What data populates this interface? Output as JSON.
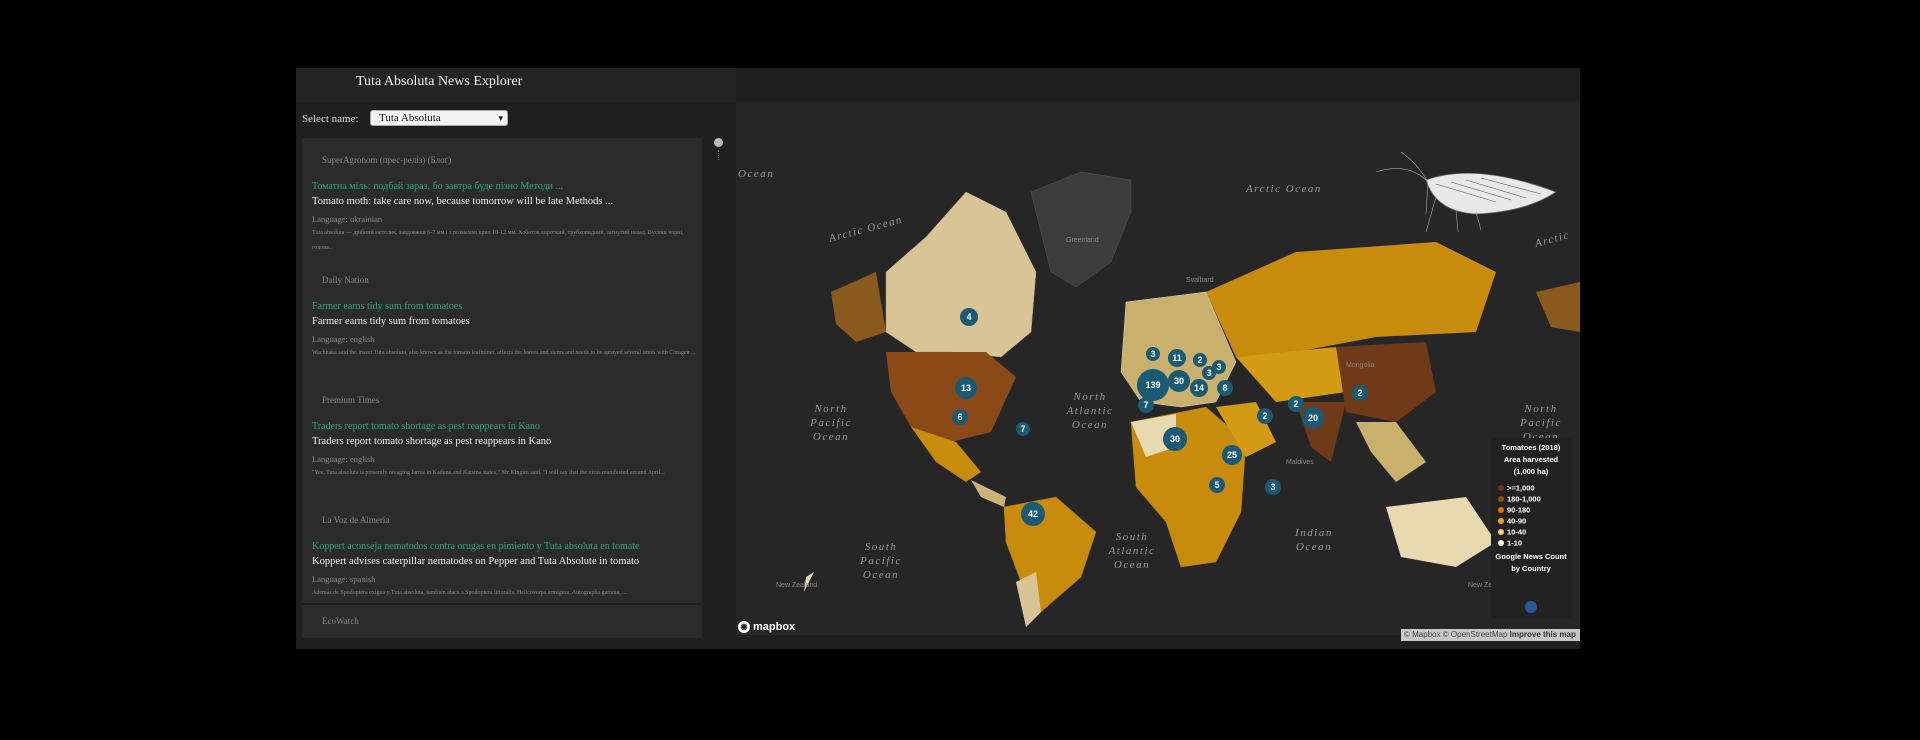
{
  "app": {
    "title": "Tuta Absoluta News Explorer"
  },
  "selector": {
    "label": "Select name:",
    "selected": "Tuta Absoluta"
  },
  "news": [
    {
      "source": "SuperAgronom (прес-реліз) (Блог)",
      "original_title": "Томатна міль: подбай зараз, бо завтра буде пізно Методи ...",
      "translated_title": "Tomato moth: take care now, because tomorrow will be late Methods ...",
      "language": "Language: ukrainian",
      "snippet": "Tuta absoluta — дрібний метелик, завдовжки 6-7 мм і з розмахом крил 10-12 мм. Хоботок короткий, трубковидний, загнутий назад. Вусики чорні, голова..."
    },
    {
      "source": "Daily Nation",
      "original_title": "Farmer earns tidy sum from tomatoes",
      "translated_title": "Farmer earns tidy sum from tomatoes",
      "language": "Language: english",
      "snippet": "Wachhaka said the insect Tuta absoluta, also known as the tomato leafminer, affects the leaves and stems and needs to be sprayed several times with Coragen ..."
    },
    {
      "source": "Premium Times",
      "original_title": "Traders report tomato shortage as pest reappears in Kano",
      "translated_title": "Traders report tomato shortage as pest reappears in Kano",
      "language": "Language: english",
      "snippet": "\"Yes, Tuta absoluta is presently ravaging farms in Kaduna and Katsina states,\" Mr Kingim said. \"I will say that the virus manifested around April..."
    },
    {
      "source": "La Voz de Almería",
      "original_title": "Koppert aconseja nematodos contra orugas en pimiento y Tuta absoluta en tomate",
      "translated_title": "Koppert advises caterpillar nematodes on Pepper and Tuta Absolute in tomato",
      "language": "Language: spanish",
      "snippet": "Además de Spodoptera exigua y Tuta absoluta, también ataca a Spodoptera littoralis, Helicoverpa armigera, Autographa gamma, ..."
    },
    {
      "source": "EcoWatch",
      "original_title": "",
      "translated_title": "",
      "language": "",
      "snippet": ""
    }
  ],
  "map": {
    "ocean_labels": [
      {
        "text": "Arctic Ocean"
      },
      {
        "text": "Arctic Ocean"
      },
      {
        "text": "Arctic"
      },
      {
        "text": "Ocean"
      },
      {
        "text": "North"
      },
      {
        "text": "Pacific"
      },
      {
        "text": "Ocean"
      },
      {
        "text": "North"
      },
      {
        "text": "Atlantic"
      },
      {
        "text": "Ocean"
      },
      {
        "text": "North"
      },
      {
        "text": "Pacific"
      },
      {
        "text": "Ocean"
      },
      {
        "text": "South"
      },
      {
        "text": "Pacific"
      },
      {
        "text": "Ocean"
      },
      {
        "text": "South"
      },
      {
        "text": "Atlantic"
      },
      {
        "text": "Ocean"
      },
      {
        "text": "Indian"
      },
      {
        "text": "Ocean"
      }
    ],
    "place_labels": [
      "Greenland",
      "Svalbard",
      "Mongolia",
      "Maldives",
      "New Zealand",
      "New Zea"
    ],
    "clusters": [
      {
        "count": "4"
      },
      {
        "count": "13"
      },
      {
        "count": "6"
      },
      {
        "count": "7"
      },
      {
        "count": "42"
      },
      {
        "count": "139"
      },
      {
        "count": "11"
      },
      {
        "count": "3"
      },
      {
        "count": "30"
      },
      {
        "count": "3"
      },
      {
        "count": "14"
      },
      {
        "count": "8"
      },
      {
        "count": "2"
      },
      {
        "count": "3"
      },
      {
        "count": "7"
      },
      {
        "count": "2"
      },
      {
        "count": "2"
      },
      {
        "count": "20"
      },
      {
        "count": "30"
      },
      {
        "count": "25"
      },
      {
        "count": "5"
      },
      {
        "count": "3"
      },
      {
        "count": "2"
      }
    ],
    "colors": {
      "high": "#7c4219",
      "mid1": "#8a5a1c",
      "mid2": "#c98b0c",
      "mid3": "#d39a14",
      "low1": "#cdb178",
      "low2": "#e7d9b0",
      "cluster": "#1a5a74"
    }
  },
  "legend": {
    "title_1": "Tomatoes (2018)",
    "title_2": "Area harvested",
    "title_3": "(1,000 ha)",
    "items": [
      {
        "label": ">=1,000",
        "color": "#7c2d12"
      },
      {
        "label": "180-1,000",
        "color": "#9a4a0e"
      },
      {
        "label": "90-180",
        "color": "#d97706"
      },
      {
        "label": "40-90",
        "color": "#f5a10c"
      },
      {
        "label": "10-40",
        "color": "#fbd27a"
      },
      {
        "label": "1-10",
        "color": "#fdf3d8"
      }
    ],
    "news_1": "Google News Count",
    "news_2": "by Country"
  },
  "footer": {
    "logo": "mapbox",
    "attribution": "© Mapbox © OpenStreetMap",
    "improve": "Improve this map"
  }
}
